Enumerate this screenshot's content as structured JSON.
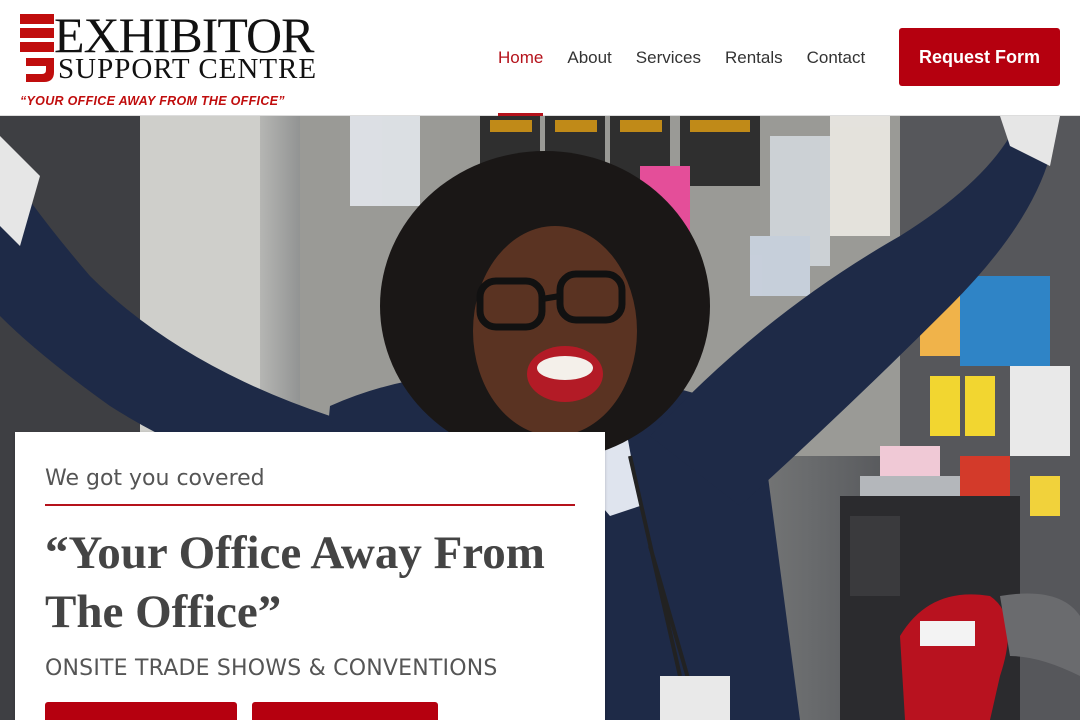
{
  "brand": {
    "line1": "EXHIBITOR",
    "line2": "SUPPORT CENTRE",
    "tagline": "“YOUR OFFICE AWAY FROM THE OFFICE”",
    "accent_color": "#b5121b"
  },
  "nav": {
    "items": [
      {
        "label": "Home",
        "active": true
      },
      {
        "label": "About",
        "active": false
      },
      {
        "label": "Services",
        "active": false
      },
      {
        "label": "Rentals",
        "active": false
      },
      {
        "label": "Contact",
        "active": false
      }
    ]
  },
  "cta": {
    "request_form_label": "Request Form"
  },
  "hero": {
    "image_icon": "hero-photo"
  },
  "card": {
    "eyebrow": "We got you covered",
    "headline": "“Your Office Away From The Office”",
    "subheading": "ONSITE TRADE SHOWS & CONVENTIONS"
  }
}
